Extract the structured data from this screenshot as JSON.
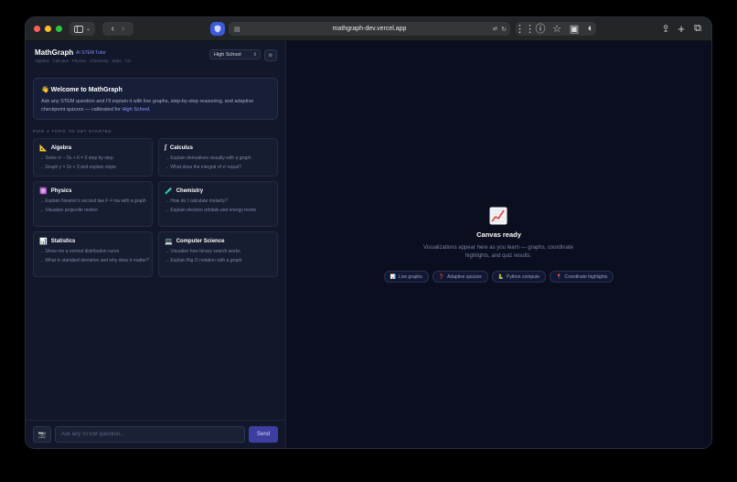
{
  "browser": {
    "url": "mathgraph-dev.vercel.app",
    "icons": [
      "sidebar-icon",
      "back-icon",
      "forward-icon",
      "shield-icon",
      "page-icon",
      "translate-icon",
      "reload-icon",
      "grid-icon",
      "info-icon",
      "star-icon",
      "print-icon",
      "reader-icon",
      "share-icon",
      "new-tab-icon",
      "tabs-icon"
    ]
  },
  "app": {
    "title": "MathGraph",
    "subtitle": "AI STEM Tutor",
    "tagline": "Algebra · Calculus · Physics · Chemistry · Stats · CS",
    "level": "High School"
  },
  "welcome": {
    "icon": "👋",
    "title": "Welcome to MathGraph",
    "text_before": "Ask any STEM question and I'll explain it with live graphs, step-by-step reasoning, and adaptive checkpoint quizzes — calibrated for ",
    "text_accent": "High School",
    "text_after": "."
  },
  "section_label": "PICK A TOPIC TO GET STARTED",
  "topics": [
    {
      "icon": "📐",
      "title": "Algebra",
      "items": [
        "→ Solve x² − 5x + 6 = 0 step by step",
        "→ Graph y = 2x + 3 and explain slope"
      ]
    },
    {
      "icon": "∫",
      "title": "Calculus",
      "items": [
        "→ Explain derivatives visually with a graph",
        "→ What does the integral of x² equal?"
      ]
    },
    {
      "icon": "⚛️",
      "title": "Physics",
      "items": [
        "→ Explain Newton's second law F = ma with a graph",
        "→ Visualize projectile motion"
      ]
    },
    {
      "icon": "🧪",
      "title": "Chemistry",
      "items": [
        "→ How do I calculate molarity?",
        "→ Explain electron orbitals and energy levels"
      ]
    },
    {
      "icon": "📊",
      "title": "Statistics",
      "items": [
        "→ Show me a normal distribution curve",
        "→ What is standard deviation and why does it matter?"
      ]
    },
    {
      "icon": "💻",
      "title": "Computer Science",
      "items": [
        "→ Visualize how binary search works",
        "→ Explain Big O notation with a graph"
      ]
    }
  ],
  "input": {
    "camera_icon": "📷",
    "placeholder": "Ask any STEM question...",
    "send_label": "Send"
  },
  "canvas": {
    "title": "Canvas ready",
    "description": "Visualizations appear here as you learn — graphs, coordinate highlights, and quiz results.",
    "pills": [
      {
        "icon": "📊",
        "label": "Live graphs"
      },
      {
        "icon": "❓",
        "label": "Adaptive quizzes"
      },
      {
        "icon": "🐍",
        "label": "Python compute"
      },
      {
        "icon": "📍",
        "label": "Coordinate highlights"
      }
    ]
  },
  "colors": {
    "accent": "#7f8cff",
    "send": "#3d3fa0",
    "background": "#0b0e1f",
    "sidebar": "#121829"
  }
}
